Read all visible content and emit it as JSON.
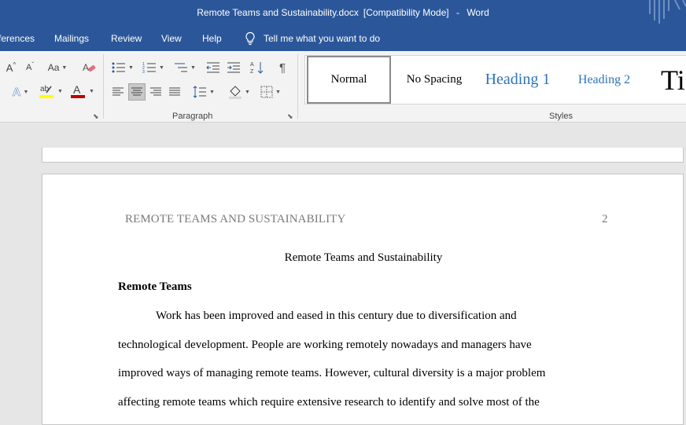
{
  "window": {
    "doc_name": "Remote Teams and Sustainability.docx",
    "mode": "[Compatibility Mode]",
    "sep": "-",
    "app": "Word"
  },
  "menu": {
    "tabs": [
      "ferences",
      "Mailings",
      "Review",
      "View",
      "Help"
    ],
    "tellme": "Tell me what you want to do"
  },
  "ribbon": {
    "paragraph_label": "Paragraph",
    "styles_label": "Styles",
    "change_case": "Aa",
    "font_color": "#c00000",
    "highlight_color": "#ffff00",
    "styles": [
      "Normal",
      "No Spacing",
      "Heading 1",
      "Heading 2",
      "Ti"
    ]
  },
  "document": {
    "header_text": "REMOTE TEAMS AND SUSTAINABILITY",
    "page_number": "2",
    "title": "Remote Teams and Sustainability",
    "heading": "Remote Teams",
    "lines": [
      "Work has been improved and eased in this century due to diversification and",
      "technological development. People are working remotely nowadays and managers have",
      "improved ways of managing remote teams. However, cultural diversity is a major problem",
      "affecting remote teams which require extensive research to identify and solve most of the"
    ]
  }
}
